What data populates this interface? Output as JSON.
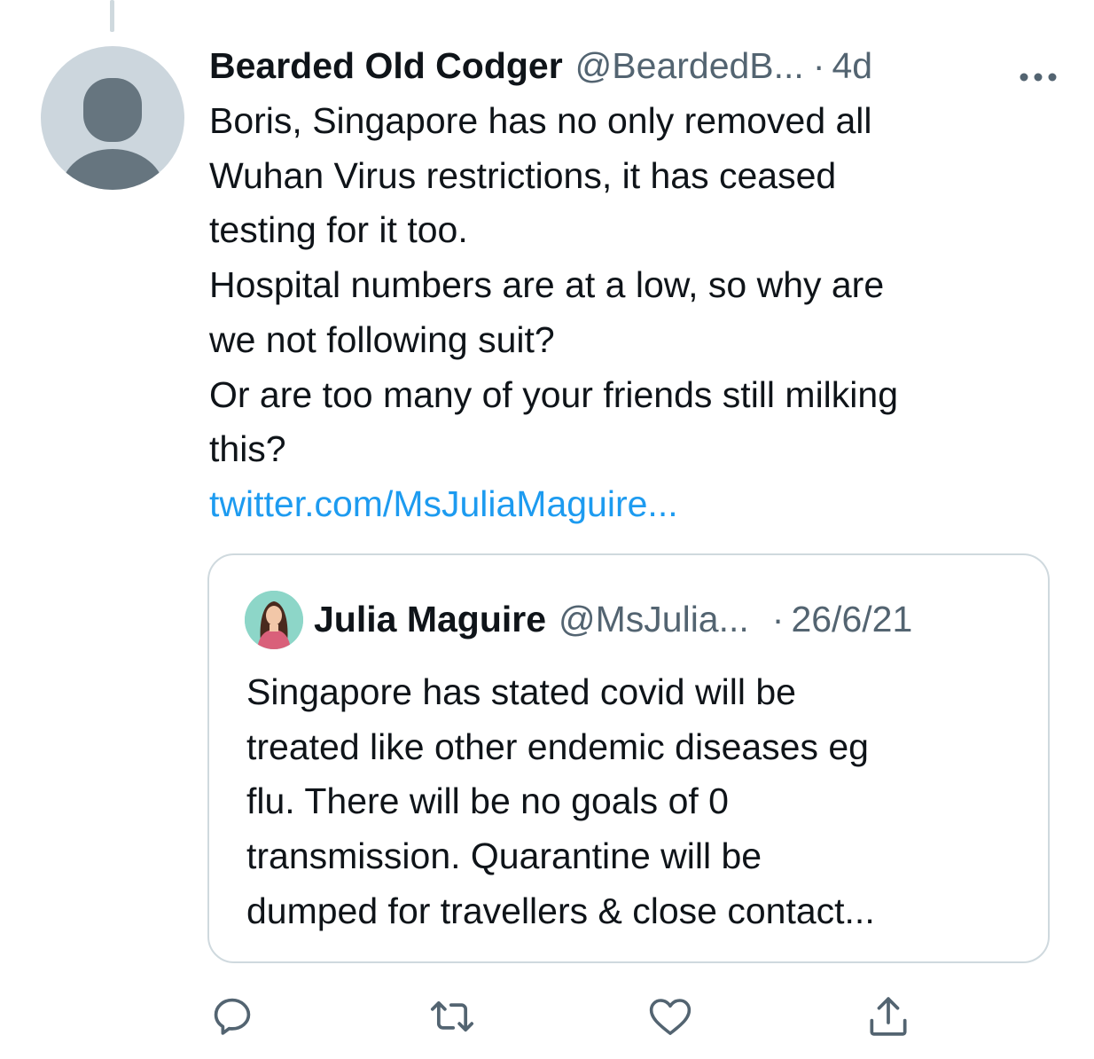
{
  "tweet": {
    "author_name": "Bearded Old Codger",
    "author_handle": "@BeardedB...",
    "separator": "·",
    "time": "4d",
    "text_lines": [
      "Boris, Singapore has no only removed all",
      "Wuhan Virus restrictions, it has ceased",
      "testing for it too.",
      "Hospital numbers are at a low, so why are",
      "we not following suit?",
      "Or are too many of your friends still milking",
      "this?"
    ],
    "link": "twitter.com/MsJuliaMaguire..."
  },
  "quoted_tweet": {
    "author_name": "Julia Maguire",
    "author_handle": "@MsJulia...",
    "separator": "·",
    "date": "26/6/21",
    "text_lines": [
      "Singapore has stated covid will be",
      "treated like other endemic diseases eg",
      "flu. There will be no goals of 0",
      "transmission. Quarantine will be",
      "dumped for travellers & close contact..."
    ]
  },
  "icons": {
    "more": "more-horizontal-icon",
    "reply": "reply-icon",
    "retweet": "retweet-icon",
    "like": "like-icon",
    "share": "share-icon"
  },
  "colors": {
    "link": "#1d9bf0",
    "secondary_text": "#536471",
    "icon": "#536471",
    "border": "#cfd9de",
    "avatar_placeholder": "#ccd6dd"
  }
}
